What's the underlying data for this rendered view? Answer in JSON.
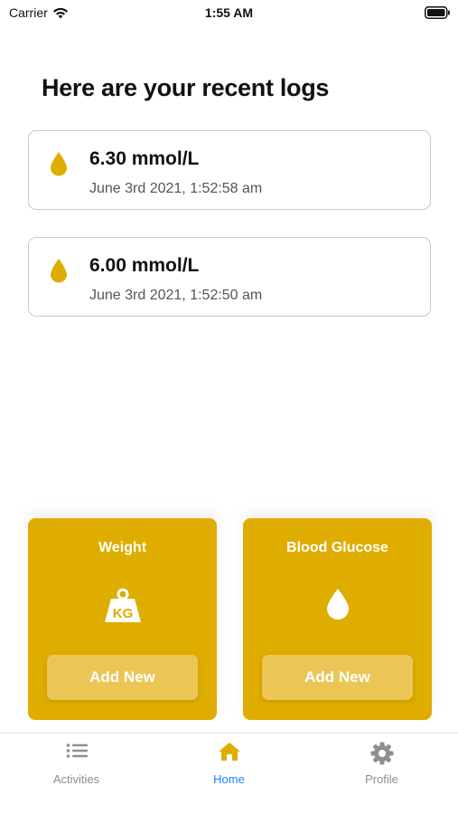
{
  "status_bar": {
    "carrier": "Carrier",
    "time": "1:55 AM"
  },
  "page_title": "Here are your recent logs",
  "logs": [
    {
      "value": "6.30 mmol/L",
      "time": "June 3rd 2021, 1:52:58 am"
    },
    {
      "value": "6.00 mmol/L",
      "time": "June 3rd 2021, 1:52:50 am"
    }
  ],
  "actions": [
    {
      "title": "Weight",
      "icon": "weight-kg-icon",
      "button": "Add New"
    },
    {
      "title": "Blood Glucose",
      "icon": "blood-drop-icon",
      "button": "Add New"
    }
  ],
  "tabs": [
    {
      "label": "Activities",
      "icon": "list-icon"
    },
    {
      "label": "Home",
      "icon": "home-icon",
      "active": true
    },
    {
      "label": "Profile",
      "icon": "gear-icon"
    }
  ],
  "colors": {
    "accent": "#dfad00",
    "button": "#ecc557",
    "active_tab": "#1a82ff",
    "inactive_tab": "#8e8e93"
  }
}
